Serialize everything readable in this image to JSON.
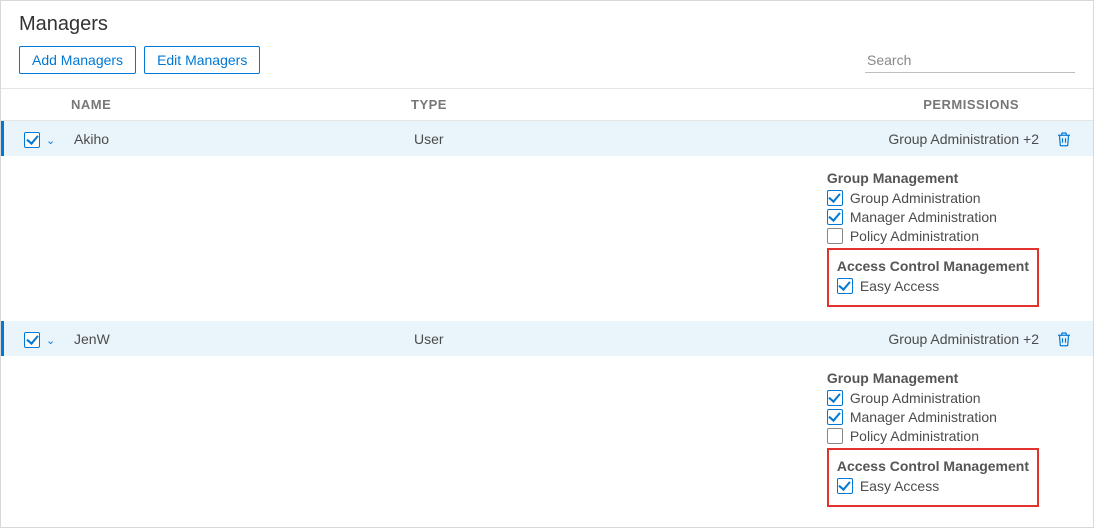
{
  "title": "Managers",
  "toolbar": {
    "add_label": "Add Managers",
    "edit_label": "Edit Managers",
    "search_placeholder": "Search"
  },
  "columns": {
    "name": "NAME",
    "type": "TYPE",
    "permissions": "PERMISSIONS"
  },
  "rows": [
    {
      "name": "Akiho",
      "type": "User",
      "summary": "Group Administration +2",
      "sections": [
        {
          "title": "Group Management",
          "highlight": false,
          "items": [
            {
              "label": "Group Administration",
              "checked": true
            },
            {
              "label": "Manager Administration",
              "checked": true
            },
            {
              "label": "Policy Administration",
              "checked": false
            }
          ]
        },
        {
          "title": "Access Control Management",
          "highlight": true,
          "items": [
            {
              "label": "Easy Access",
              "checked": true
            }
          ]
        }
      ]
    },
    {
      "name": "JenW",
      "type": "User",
      "summary": "Group Administration +2",
      "sections": [
        {
          "title": "Group Management",
          "highlight": false,
          "items": [
            {
              "label": "Group Administration",
              "checked": true
            },
            {
              "label": "Manager Administration",
              "checked": true
            },
            {
              "label": "Policy Administration",
              "checked": false
            }
          ]
        },
        {
          "title": "Access Control Management",
          "highlight": true,
          "items": [
            {
              "label": "Easy Access",
              "checked": true
            }
          ]
        }
      ]
    }
  ]
}
